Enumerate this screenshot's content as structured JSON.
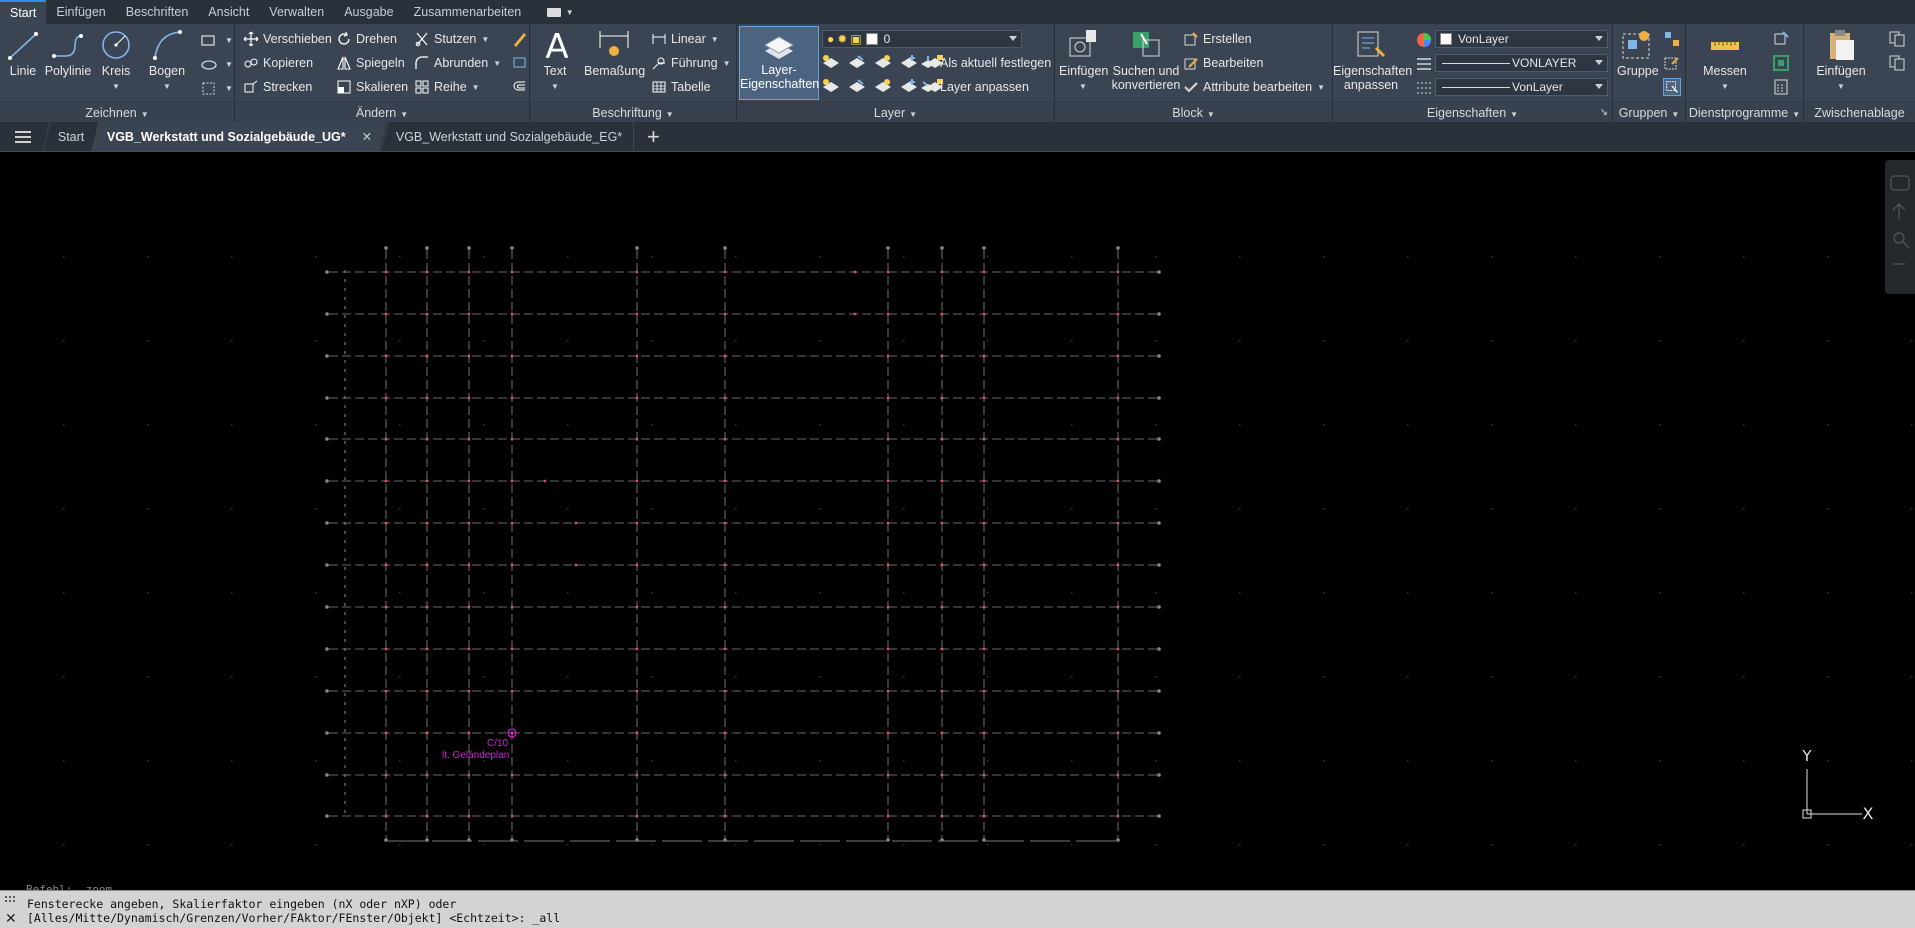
{
  "ribbon_tabs": [
    "Start",
    "Einfügen",
    "Beschriften",
    "Ansicht",
    "Verwalten",
    "Ausgabe",
    "Zusammenarbeiten"
  ],
  "panels": {
    "zeichnen": {
      "title": "Zeichnen",
      "linie": "Linie",
      "polylinie": "Polylinie",
      "kreis": "Kreis",
      "bogen": "Bogen"
    },
    "aendern": {
      "title": "Ändern",
      "verschieben": "Verschieben",
      "drehen": "Drehen",
      "stutzen": "Stutzen",
      "kopieren": "Kopieren",
      "spiegeln": "Spiegeln",
      "abrunden": "Abrunden",
      "strecken": "Strecken",
      "skalieren": "Skalieren",
      "reihe": "Reihe"
    },
    "beschriftung": {
      "title": "Beschriftung",
      "text": "Text",
      "bemassung": "Bemaßung",
      "linear": "Linear",
      "fuehrung": "Führung",
      "tabelle": "Tabelle"
    },
    "layer": {
      "title": "Layer",
      "layer_eig_1": "Layer-",
      "layer_eig_2": "Eigenschaften",
      "current_layer": "0",
      "als_aktuell": "Als aktuell festlegen",
      "anpassen": "Layer anpassen"
    },
    "block": {
      "title": "Block",
      "einfuegen": "Einfügen",
      "suchen_1": "Suchen und",
      "suchen_2": "konvertieren",
      "erstellen": "Erstellen",
      "bearbeiten": "Bearbeiten",
      "attribute": "Attribute bearbeiten"
    },
    "eigenschaften": {
      "title": "Eigenschaften",
      "anpassen_1": "Eigenschaften",
      "anpassen_2": "anpassen",
      "color": "VonLayer",
      "linetype": "VONLAYER",
      "lineweight": "VonLayer"
    },
    "gruppen": {
      "title": "Gruppen",
      "gruppe": "Gruppe"
    },
    "dienstprogramme": {
      "title": "Dienstprogramme",
      "messen": "Messen"
    },
    "zwischenablage": {
      "title": "Zwischenablage",
      "einfuegen": "Einfügen"
    }
  },
  "file_tabs": {
    "start": "Start",
    "active": "VGB_Werkstatt und Sozialgebäude_UG*",
    "other": "VGB_Werkstatt und Sozialgebäude_EG*"
  },
  "drawing": {
    "annotation_1": "C/10",
    "annotation_2": "lt. Geländeplan",
    "ucs_y": "Y",
    "ucs_x": "X",
    "colors": {
      "grid": "#8a8a8a",
      "marker": "#e0506a",
      "annotation": "#d020d0"
    }
  },
  "command": {
    "history": "Befehl: _zoom",
    "line1": "Fensterecke angeben, Skalierfaktor eingeben (nX oder nXP) oder",
    "line2": "[Alles/Mitte/Dynamisch/Grenzen/Vorher/FAktor/FEnster/Objekt] <Echtzeit>: _all"
  }
}
